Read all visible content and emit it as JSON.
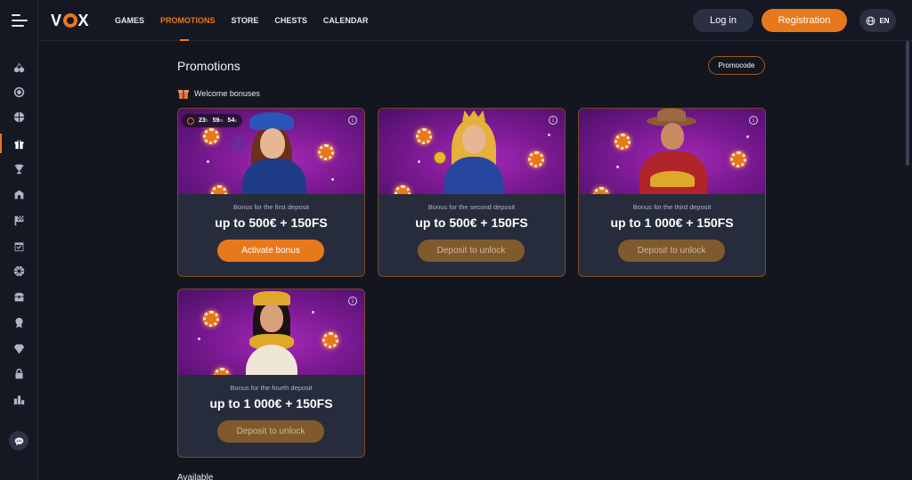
{
  "brand": "VOX",
  "nav": [
    "GAMES",
    "PROMOTIONS",
    "STORE",
    "CHESTS",
    "CALENDAR"
  ],
  "header": {
    "login": "Log in",
    "register": "Registration",
    "lang": "EN"
  },
  "page": {
    "title": "Promotions",
    "promocode": "Promocode",
    "section": "Welcome bonuses",
    "next_section": "Available"
  },
  "timer": {
    "h": "23",
    "h_unit": "h",
    "m": "59",
    "m_unit": "m",
    "s": "54",
    "s_unit": "s"
  },
  "cards": [
    {
      "subtitle": "Bonus for the first deposit",
      "title": "up to 500€ + 150FS",
      "button": "Activate bonus"
    },
    {
      "subtitle": "Bonus for the second deposit",
      "title": "up to 500€ + 150FS",
      "button": "Deposit to unlock"
    },
    {
      "subtitle": "Bonus for the third deposit",
      "title": "up to 1 000€ + 150FS",
      "button": "Deposit to unlock"
    },
    {
      "subtitle": "Bonus for the fourth deposit",
      "title": "up to 1 000€ + 150FS",
      "button": "Deposit to unlock"
    }
  ],
  "info_glyph": "i",
  "sidebar_icons": [
    "cherries-icon",
    "target-icon",
    "basketball-icon",
    "gift-icon",
    "trophy-icon",
    "shop-icon",
    "race-flag-icon",
    "calendar-icon",
    "wheel-icon",
    "chest-icon",
    "badge-icon",
    "diamond-icon",
    "lock-icon",
    "leaderboard-icon"
  ],
  "colors": {
    "accent": "#e8781c",
    "bg": "#13151f",
    "card": "#272c3c"
  }
}
